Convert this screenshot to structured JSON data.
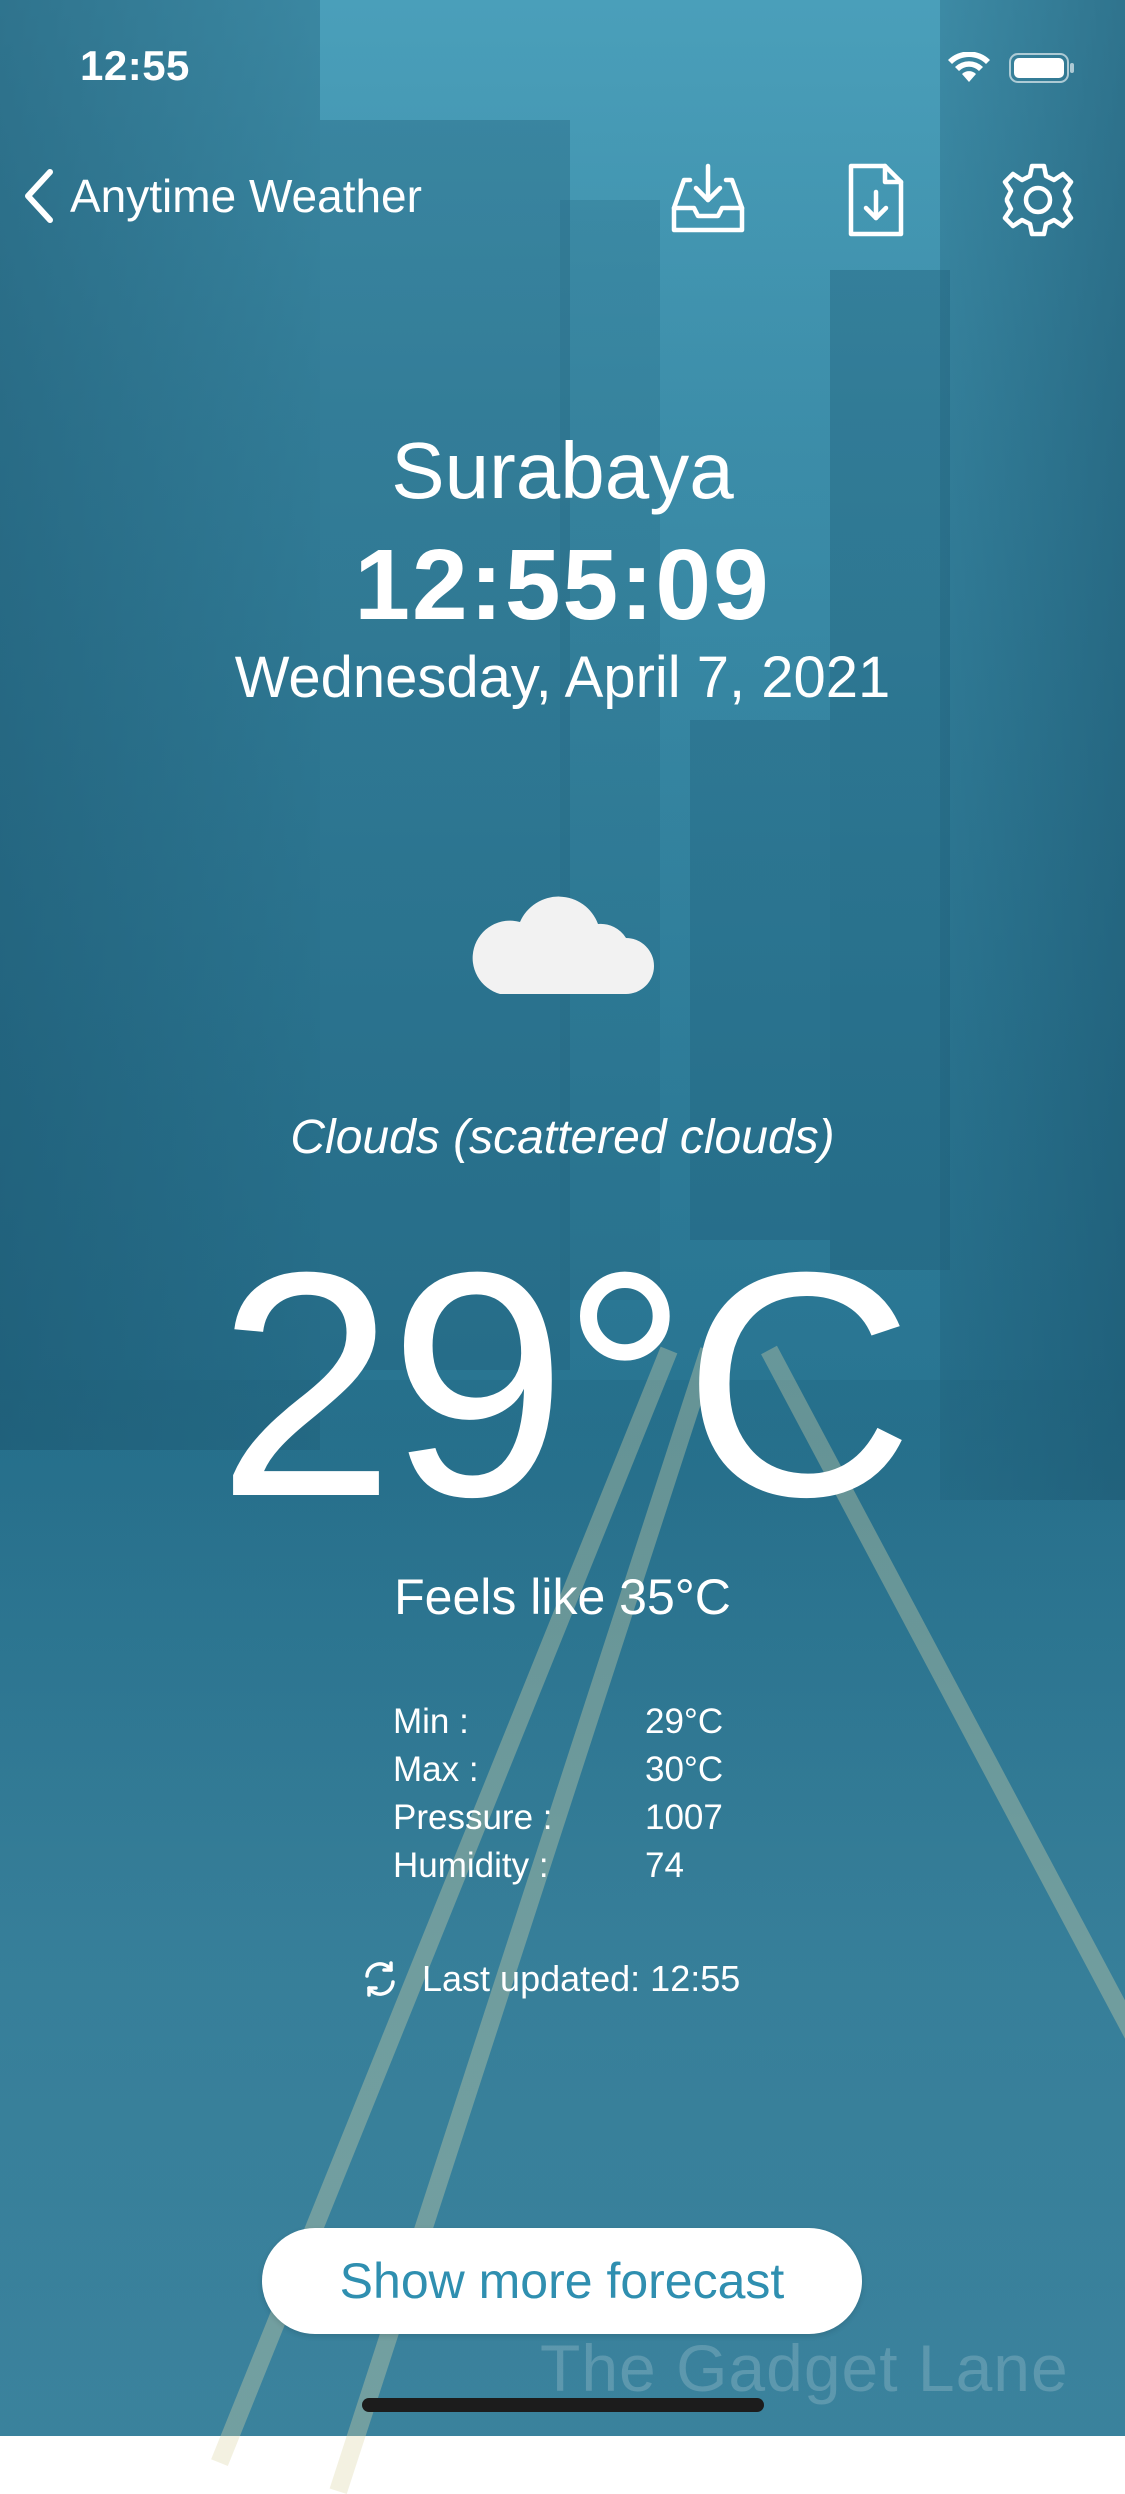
{
  "status_bar": {
    "time": "12:55"
  },
  "nav": {
    "back_title": "Anytime Weather",
    "icons": [
      "inbox-download-icon",
      "file-download-icon",
      "gear-icon"
    ]
  },
  "location": {
    "city": "Surabaya",
    "clock": "12:55:09",
    "date": "Wednesday, April 7, 2021"
  },
  "weather": {
    "icon": "cloud-icon",
    "description": "Clouds (scattered clouds)",
    "temperature": "29°C",
    "feels_like": "Feels like 35°C"
  },
  "stats": [
    {
      "label": "Min :",
      "value": "29°C"
    },
    {
      "label": "Max :",
      "value": "30°C"
    },
    {
      "label": "Pressure :",
      "value": "1007"
    },
    {
      "label": "Humidity :",
      "value": "74"
    }
  ],
  "last_updated": "Last updated: 12:55",
  "button": {
    "label": "Show more forecast"
  },
  "watermark": "The Gadget Lane"
}
